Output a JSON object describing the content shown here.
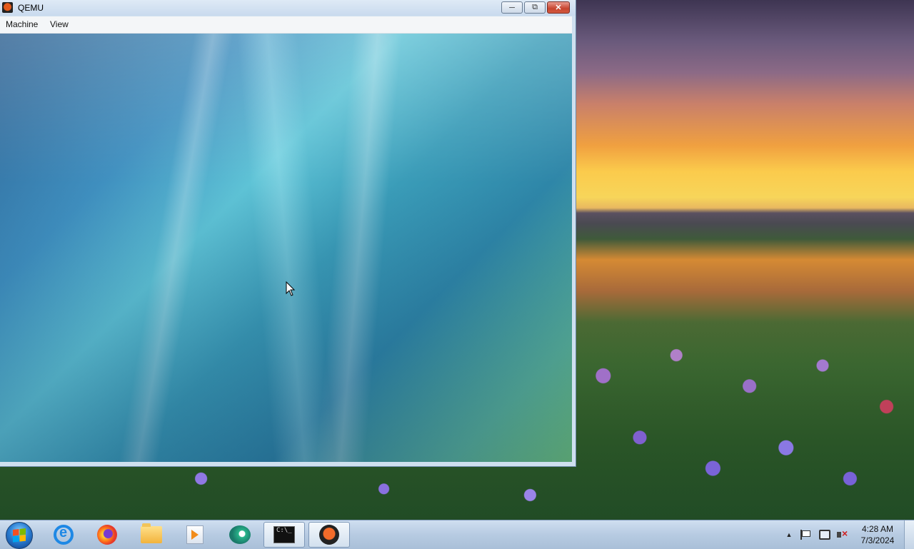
{
  "window": {
    "title": "QEMU",
    "menu": [
      "Machine",
      "View"
    ],
    "controls": {
      "minimize": "minimize",
      "restore": "restore",
      "close": "close"
    }
  },
  "taskbar": {
    "items": [
      {
        "icon": "start-orb-icon"
      },
      {
        "icon": "internet-explorer-icon"
      },
      {
        "icon": "firefox-icon"
      },
      {
        "icon": "file-explorer-icon"
      },
      {
        "icon": "media-player-icon"
      },
      {
        "icon": "messenger-icon"
      },
      {
        "icon": "command-prompt-icon",
        "active": true
      },
      {
        "icon": "qemu-icon",
        "active": true
      }
    ],
    "tray": {
      "icons": [
        "show-hidden-icons-arrow",
        "action-center-flag-icon",
        "network-icon",
        "volume-muted-icon"
      ],
      "time": "4:28 AM",
      "date": "7/3/2024"
    }
  }
}
